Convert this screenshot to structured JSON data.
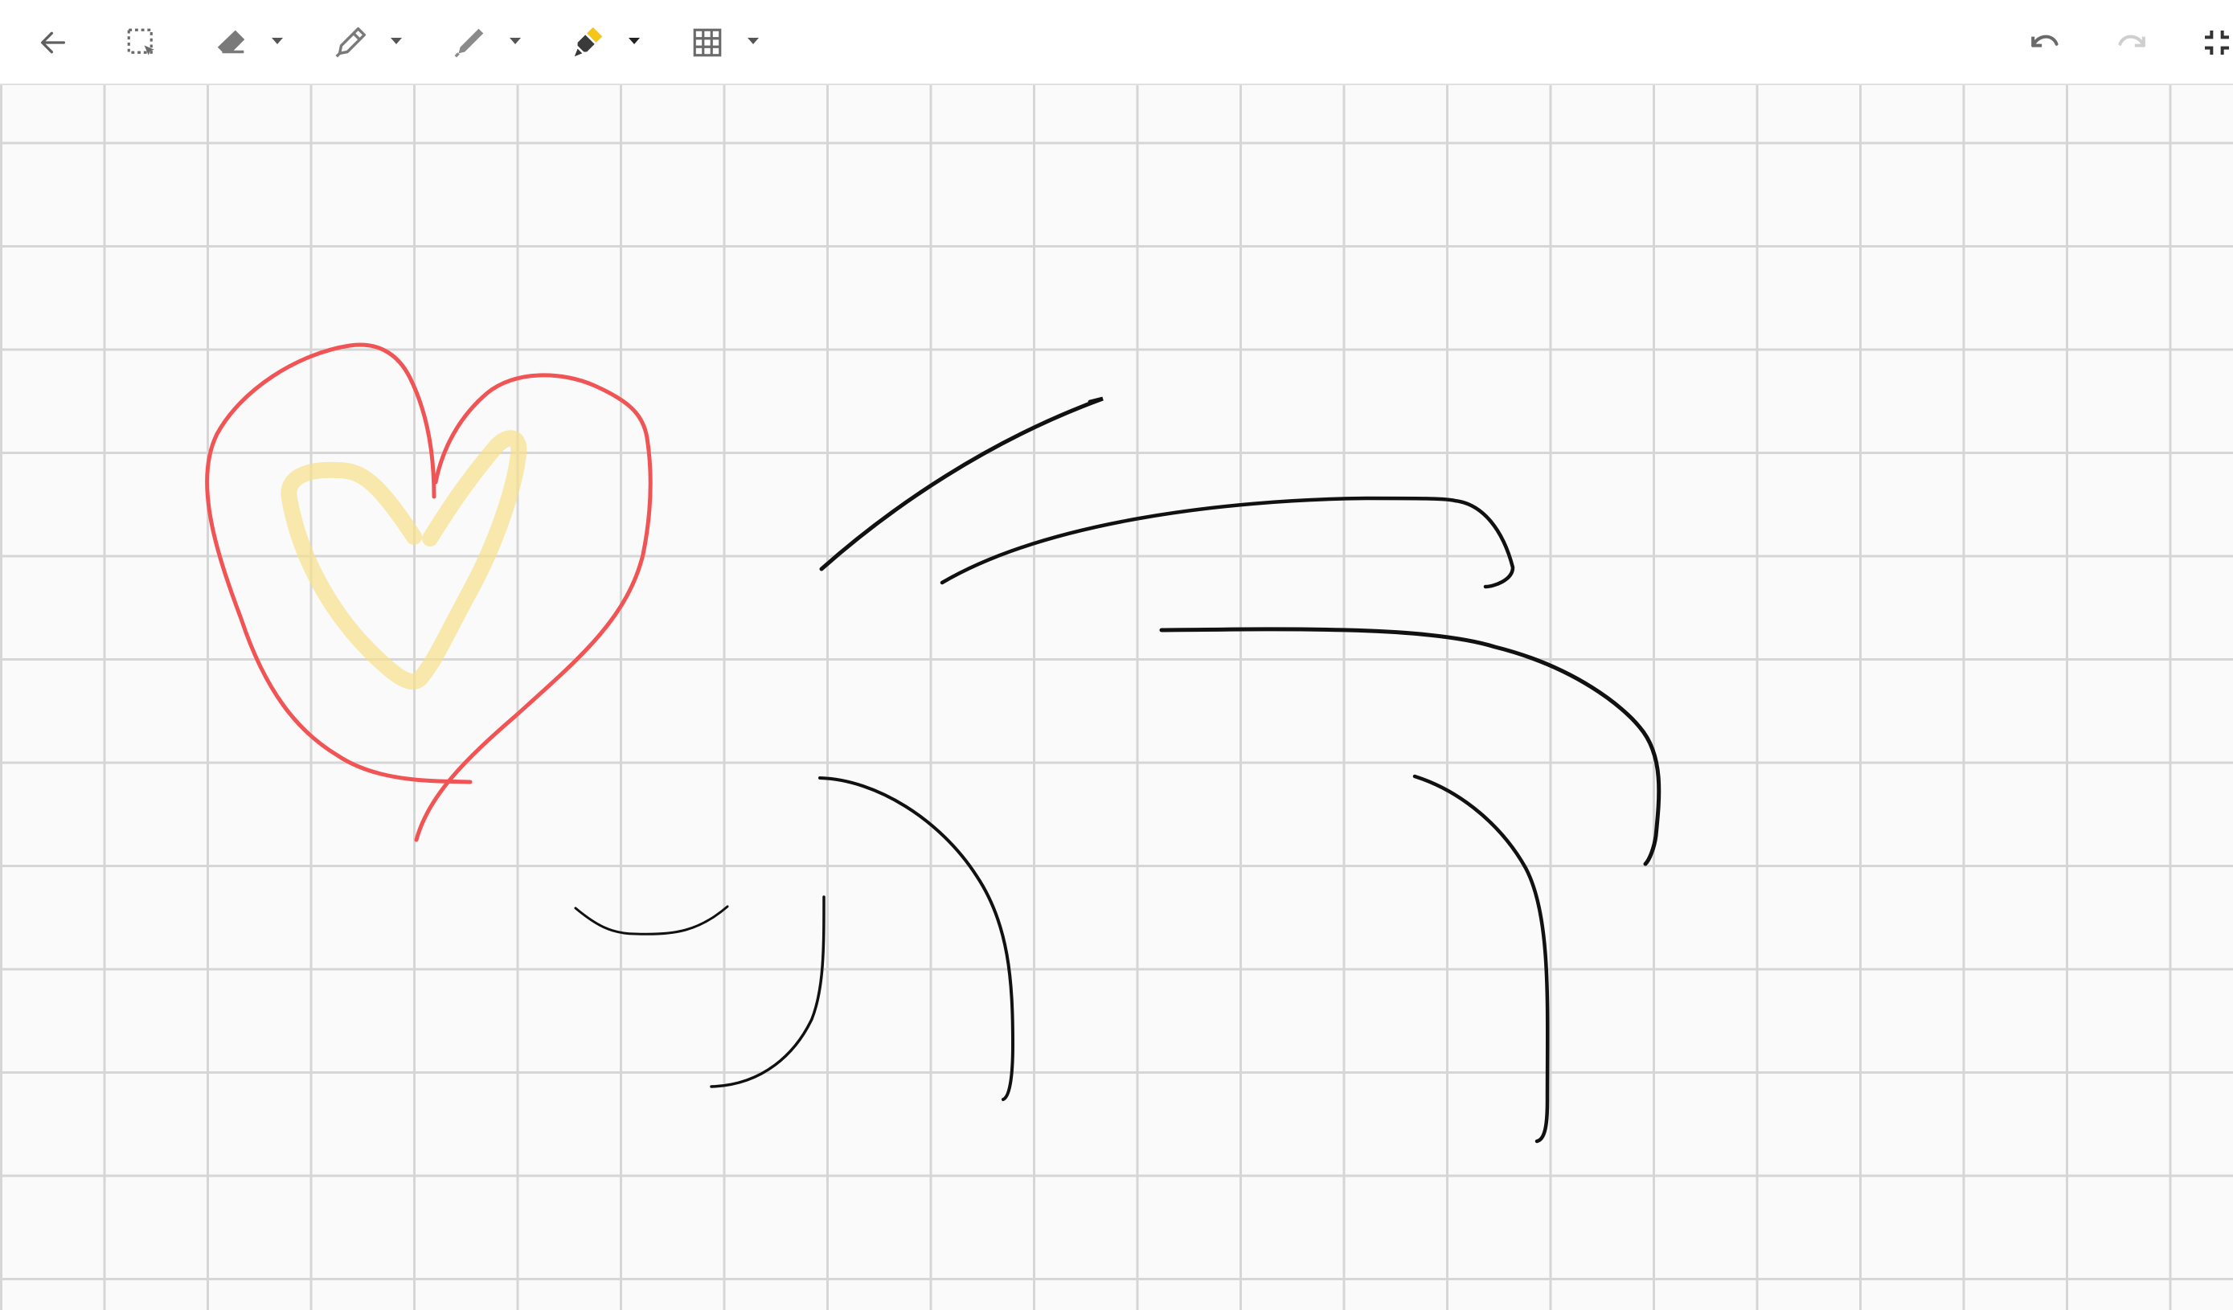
{
  "app": {
    "title": "",
    "background": "#fafafa",
    "grid_color": "#d6d6d6"
  },
  "toolbar": {
    "items": [
      {
        "name": "back",
        "icon": "arrow-left-icon",
        "has_menu": false
      },
      {
        "name": "lasso-select",
        "icon": "lasso-select-icon",
        "has_menu": false
      },
      {
        "name": "eraser",
        "icon": "eraser-icon",
        "has_menu": true
      },
      {
        "name": "pen",
        "icon": "pen-icon",
        "has_menu": true
      },
      {
        "name": "pencil",
        "icon": "pencil-icon",
        "has_menu": true
      },
      {
        "name": "highlighter",
        "icon": "highlighter-icon",
        "has_menu": true,
        "color": "#f5c518",
        "active": true
      },
      {
        "name": "background-grid",
        "icon": "grid-icon",
        "has_menu": true
      },
      {
        "name": "undo",
        "icon": "undo-icon",
        "enabled": true
      },
      {
        "name": "redo",
        "icon": "redo-icon",
        "enabled": false
      },
      {
        "name": "exit-fullscreen",
        "icon": "exit-fullscreen-icon"
      }
    ]
  },
  "strokes": {
    "heart_outline": {
      "tool": "pen",
      "color": "#f05454"
    },
    "heart_inner": {
      "tool": "highlighter",
      "color": "#f7e08a"
    },
    "ink": {
      "tool": "pen",
      "color": "#111111"
    }
  }
}
